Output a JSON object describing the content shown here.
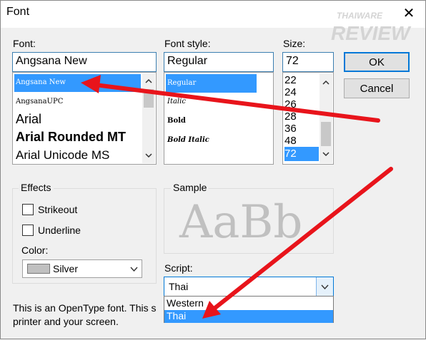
{
  "window": {
    "title": "Font",
    "close_glyph": "✕"
  },
  "watermark": {
    "brand_top": "THAIWARE",
    "brand_bottom": "REVIEW"
  },
  "font": {
    "label": "Font:",
    "value": "Angsana New",
    "items": [
      "Angsana New",
      "AngsanaUPC",
      "Arial",
      "Arial Rounded MT",
      "Arial Unicode MS"
    ],
    "selected_index": 0
  },
  "style": {
    "label": "Font style:",
    "value": "Regular",
    "items": [
      "Regular",
      "Italic",
      "Bold",
      "Bold Italic"
    ],
    "selected_index": 0
  },
  "size": {
    "label": "Size:",
    "value": "72",
    "items": [
      "22",
      "24",
      "26",
      "28",
      "36",
      "48",
      "72"
    ],
    "selected_index": 6
  },
  "buttons": {
    "ok": "OK",
    "cancel": "Cancel"
  },
  "effects": {
    "title": "Effects",
    "strikeout": "Strikeout",
    "underline": "Underline",
    "strikeout_checked": false,
    "underline_checked": false,
    "color_label": "Color:",
    "color_value": "Silver",
    "color_swatch": "#c0c0c0"
  },
  "sample": {
    "title": "Sample",
    "text": "AaBb"
  },
  "script": {
    "label": "Script:",
    "value": "Thai",
    "options": [
      "Western",
      "Thai"
    ],
    "selected_index": 1
  },
  "description": {
    "line1": "This is an OpenType font. This s",
    "line2": "printer and your screen."
  },
  "colors": {
    "selection": "#3399ff",
    "focus_border": "#0078d7",
    "annotation_arrow": "#e8141b"
  },
  "icons": {
    "scroll_up": "chevron-up-icon",
    "scroll_down": "chevron-down-icon",
    "combo": "chevron-down-icon",
    "close": "close-icon"
  }
}
